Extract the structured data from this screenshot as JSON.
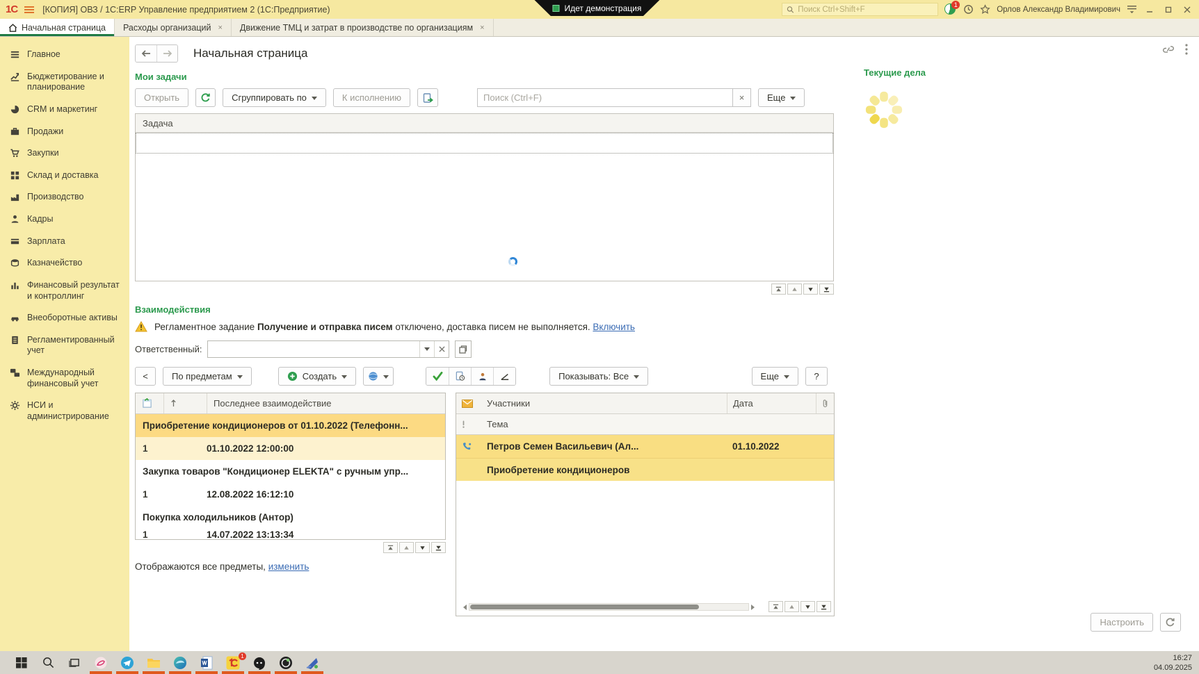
{
  "titlebar": {
    "logo": "1С",
    "title": "[КОПИЯ] ОВЗ / 1С:ERP Управление предприятием 2  (1С:Предприятие)",
    "demo_badge": "Идет демонстрация",
    "search_placeholder": "Поиск Ctrl+Shift+F",
    "notification_badge": "1",
    "user_name": "Орлов Александр Владимирович"
  },
  "tabs": [
    {
      "label": "Начальная страница"
    },
    {
      "label": "Расходы организаций",
      "close": "×"
    },
    {
      "label": "Движение ТМЦ и затрат в производстве по организациям",
      "close": "×"
    }
  ],
  "sidebar": {
    "items": [
      {
        "label": "Главное",
        "icon": "menu-icon"
      },
      {
        "label": "Бюджетирование и планирование",
        "icon": "budget-chart-icon"
      },
      {
        "label": "CRM и маркетинг",
        "icon": "pie-chart-icon"
      },
      {
        "label": "Продажи",
        "icon": "briefcase-icon"
      },
      {
        "label": "Закупки",
        "icon": "cart-icon"
      },
      {
        "label": "Склад и доставка",
        "icon": "boxes-icon"
      },
      {
        "label": "Производство",
        "icon": "factory-icon"
      },
      {
        "label": "Кадры",
        "icon": "person-icon"
      },
      {
        "label": "Зарплата",
        "icon": "wallet-icon"
      },
      {
        "label": "Казначейство",
        "icon": "coins-icon"
      },
      {
        "label": "Финансовый результат и контроллинг",
        "icon": "bar-chart-icon"
      },
      {
        "label": "Внеоборотные активы",
        "icon": "car-icon"
      },
      {
        "label": "Регламентированный учет",
        "icon": "ledger-icon"
      },
      {
        "label": "Международный финансовый учет",
        "icon": "drcr-icon"
      },
      {
        "label": "НСИ и администрирование",
        "icon": "gear-icon"
      }
    ]
  },
  "main": {
    "page_title": "Начальная страница",
    "tasks": {
      "section_title": "Мои задачи",
      "open_button": "Открыть",
      "group_by_button": "Сгруппировать по",
      "to_execution_button": "К исполнению",
      "search_placeholder": "Поиск (Ctrl+F)",
      "clear_button": "×",
      "more_button": "Еще",
      "column_task": "Задача"
    },
    "interactions": {
      "section_title": "Взаимодействия",
      "warning_prefix": "Регламентное задание",
      "warning_bold": "Получение и отправка писем",
      "warning_suffix": "отключено, доставка писем не выполняется.",
      "warning_link": "Включить",
      "responsible_label": "Ответственный:",
      "back_button": "<",
      "by_subjects_button": "По предметам",
      "create_button": "Создать",
      "show_button": "Показывать: Все",
      "more_button": "Еще",
      "help_button": "?",
      "subjects": {
        "column_header": "Последнее взаимодействие",
        "rows": [
          {
            "text": "Приобретение кондиционеров от 01.10.2022 (Телефонн..."
          },
          {
            "count": "1",
            "datetime": "01.10.2022 12:00:00"
          },
          {
            "text": "Закупка товаров \"Кондиционер ELEKTA\" с ручным упр..."
          },
          {
            "count": "1",
            "datetime": "12.08.2022 16:12:10"
          },
          {
            "text": "Покупка холодильников (Антор)"
          },
          {
            "count": "1",
            "datetime": "14.07.2022 13:13:34"
          }
        ],
        "footer_text": "Отображаются все предметы,",
        "footer_link": "изменить"
      },
      "list": {
        "column_participants": "Участники",
        "column_date": "Дата",
        "column_topic": "Тема",
        "row_participants": "Петров Семен Васильевич (Ал...",
        "row_date": "01.10.2022",
        "row_topic": "Приобретение кондиционеров"
      }
    },
    "current_affairs_title": "Текущие дела",
    "configure_button": "Настроить"
  },
  "taskbar": {
    "time": "16:27",
    "date": "04.09.2025",
    "app_badge": "1"
  }
}
